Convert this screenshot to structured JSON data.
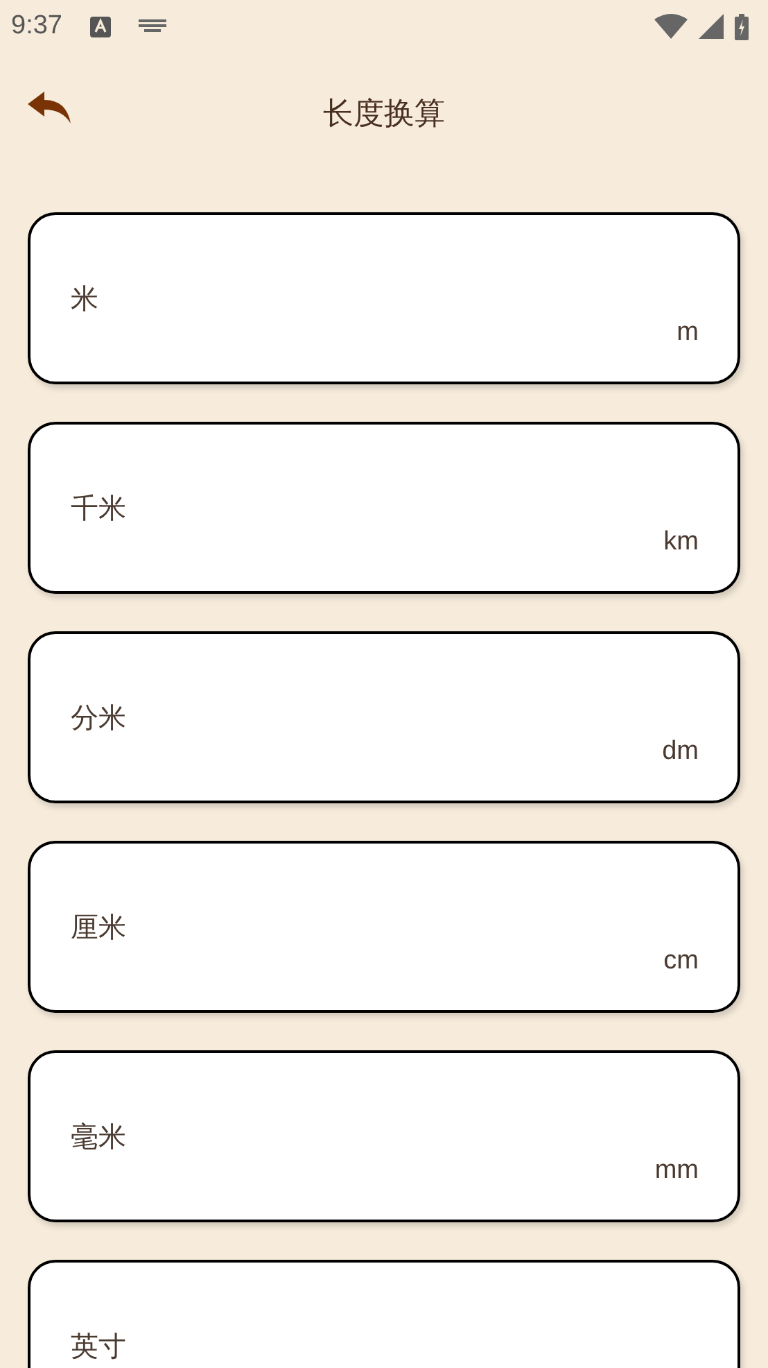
{
  "status_bar": {
    "time": "9:37"
  },
  "app_bar": {
    "title": "长度换算"
  },
  "units": [
    {
      "name": "米",
      "symbol": "m"
    },
    {
      "name": "千米",
      "symbol": "km"
    },
    {
      "name": "分米",
      "symbol": "dm"
    },
    {
      "name": "厘米",
      "symbol": "cm"
    },
    {
      "name": "毫米",
      "symbol": "mm"
    },
    {
      "name": "英寸"
    }
  ]
}
